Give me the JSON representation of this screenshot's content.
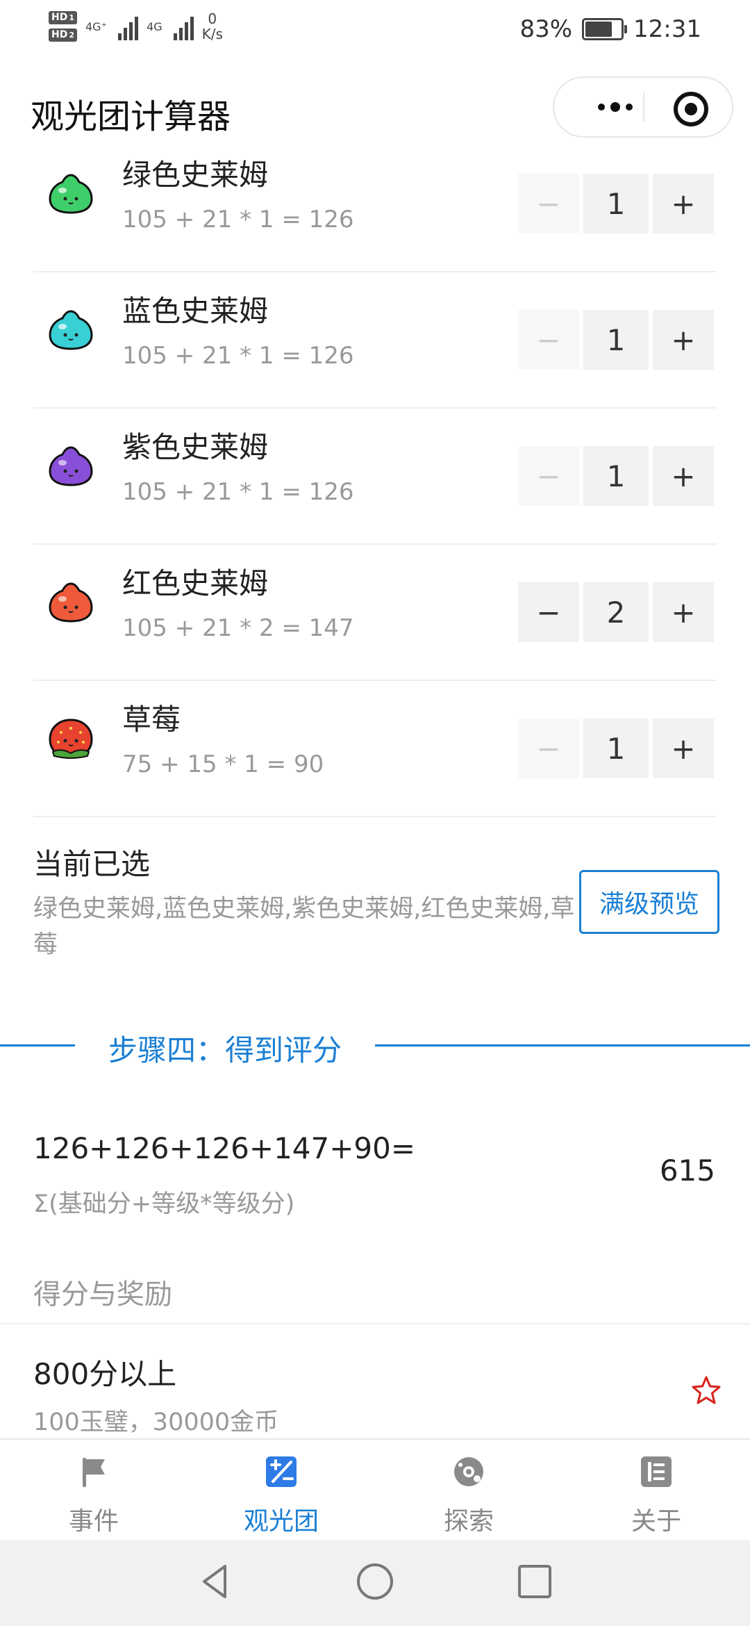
{
  "status_bar": {
    "sim1": "HD",
    "sim1_num": "1",
    "sim2": "HD",
    "sim2_num": "2",
    "network1": "4G⁺",
    "network2": "4G",
    "speed_value": "0",
    "speed_unit": "K/s",
    "battery_percent": "83%",
    "battery_level": 0.83,
    "time": "12:31"
  },
  "titlebar": {
    "title": "观光团计算器",
    "more_icon": "more-dots-icon",
    "close_icon": "target-circle-icon"
  },
  "items": [
    {
      "name": "绿色史莱姆",
      "formula": "105 + 21 * 1 = 126",
      "count": "1",
      "minus": "−",
      "plus": "+",
      "color": "#3fcf6a",
      "minus_disabled": true
    },
    {
      "name": "蓝色史莱姆",
      "formula": "105 + 21 * 1 = 126",
      "count": "1",
      "minus": "−",
      "plus": "+",
      "color": "#38d0d4",
      "minus_disabled": true
    },
    {
      "name": "紫色史莱姆",
      "formula": "105 + 21 * 1 = 126",
      "count": "1",
      "minus": "−",
      "plus": "+",
      "color": "#8a4fd8",
      "minus_disabled": true
    },
    {
      "name": "红色史莱姆",
      "formula": "105 + 21 * 2 = 147",
      "count": "2",
      "minus": "−",
      "plus": "+",
      "color": "#ef5a3a",
      "minus_disabled": false
    },
    {
      "name": "草莓",
      "formula": "75 + 15 * 1 = 90",
      "count": "1",
      "minus": "−",
      "plus": "+",
      "color": "#e8432f",
      "minus_disabled": true
    }
  ],
  "selected": {
    "title": "当前已选",
    "list": "绿色史莱姆,蓝色史莱姆,紫色史莱姆,红色史莱姆,草莓",
    "preview_button": "满级预览"
  },
  "step": {
    "label": "步骤四：得到评分"
  },
  "score": {
    "formula": "126+126+126+147+90=",
    "subtitle": "Σ(基础分+等级*等级分)",
    "total": "615"
  },
  "rewards": {
    "header": "得分与奖励",
    "items": [
      {
        "title": "800分以上",
        "desc": "100玉璧，30000金币"
      }
    ]
  },
  "tabbar": {
    "tabs": [
      {
        "label": "事件",
        "icon": "flag-icon",
        "active": false
      },
      {
        "label": "观光团",
        "icon": "calculator-icon",
        "active": true
      },
      {
        "label": "探索",
        "icon": "compass-icon",
        "active": false
      },
      {
        "label": "关于",
        "icon": "list-icon",
        "active": false
      }
    ]
  },
  "colors": {
    "accent": "#1a7fd4",
    "star": "#d9201b"
  }
}
